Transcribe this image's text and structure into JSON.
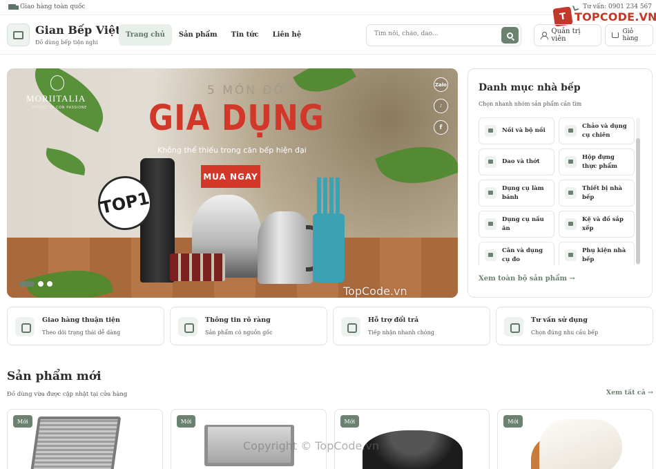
{
  "topbar": {
    "shipping_text": "Giao hàng toàn quốc",
    "phone_text": "Tư vấn: 0901 234 567"
  },
  "watermark": {
    "logo_text": "TOPCODE.VN",
    "logo_mark": "T",
    "center_text": "TopCode.vn",
    "bottom_text": "Copyright © TopCode.vn"
  },
  "header": {
    "brand_name": "Gian Bếp Việt",
    "brand_tagline": "Đồ dùng bếp tiện nghi",
    "nav": [
      {
        "label": "Trang chủ",
        "active": true
      },
      {
        "label": "Sản phẩm",
        "active": false
      },
      {
        "label": "Tin tức",
        "active": false
      },
      {
        "label": "Liên hệ",
        "active": false
      }
    ],
    "search_placeholder": "Tìm nồi, chảo, dao...",
    "admin_label": "Quản trị viên",
    "cart_label": "Giỏ hàng"
  },
  "hero": {
    "brand": "MORIITALIA",
    "brand_sub": "PRODOTTO CON PASSIONE",
    "kicker": "5 MÓN ĐỒ",
    "headline": "GIA DỤNG",
    "tagline": "Không thể thiếu trong căn bếp hiện đại",
    "cta": "MUA NGAY",
    "badge": "TOP1",
    "social": [
      "Zalo",
      "TikTok",
      "f"
    ],
    "slide_count": 3,
    "active_slide": 1
  },
  "categories": {
    "title": "Danh mục nhà bếp",
    "subtitle": "Chọn nhanh nhóm sản phẩm cần tìm",
    "items": [
      "Nồi và bộ nồi",
      "Chảo và dụng cụ chiên",
      "Dao và thớt",
      "Hộp đựng thực phẩm",
      "Dụng cụ làm bánh",
      "Thiết bị nhà bếp",
      "Dụng cụ nấu ăn",
      "Kệ và đồ sắp xếp",
      "Cân và dụng cụ đo",
      "Phụ kiện nhà bếp"
    ],
    "view_all": "Xem toàn bộ sản phẩm →"
  },
  "features": [
    {
      "title": "Giao hàng thuận tiện",
      "subtitle": "Theo dõi trạng thái dễ dàng",
      "icon": "truck-icon"
    },
    {
      "title": "Thông tin rõ ràng",
      "subtitle": "Sản phẩm có nguồn gốc",
      "icon": "shield-icon"
    },
    {
      "title": "Hỗ trợ đổi trả",
      "subtitle": "Tiếp nhận nhanh chóng",
      "icon": "return-icon"
    },
    {
      "title": "Tư vấn sử dụng",
      "subtitle": "Chọn đúng nhu cầu bếp",
      "icon": "headset-icon"
    }
  ],
  "new_products": {
    "title": "Sản phẩm mới",
    "subtitle": "Đồ dùng vừa được cập nhật tại cửa hàng",
    "see_all": "Xem tất cả →",
    "badge": "Mới",
    "items": [
      {
        "image": "baking-tray-set"
      },
      {
        "image": "stainless-dish-rack"
      },
      {
        "image": "tefal-pressure-cooker"
      },
      {
        "image": "hand-mixer"
      }
    ]
  },
  "colors": {
    "accent": "#6b8270",
    "accent_light": "#e8efe9",
    "hero_red": "#d2382a",
    "watermark_red": "#c0392b"
  }
}
